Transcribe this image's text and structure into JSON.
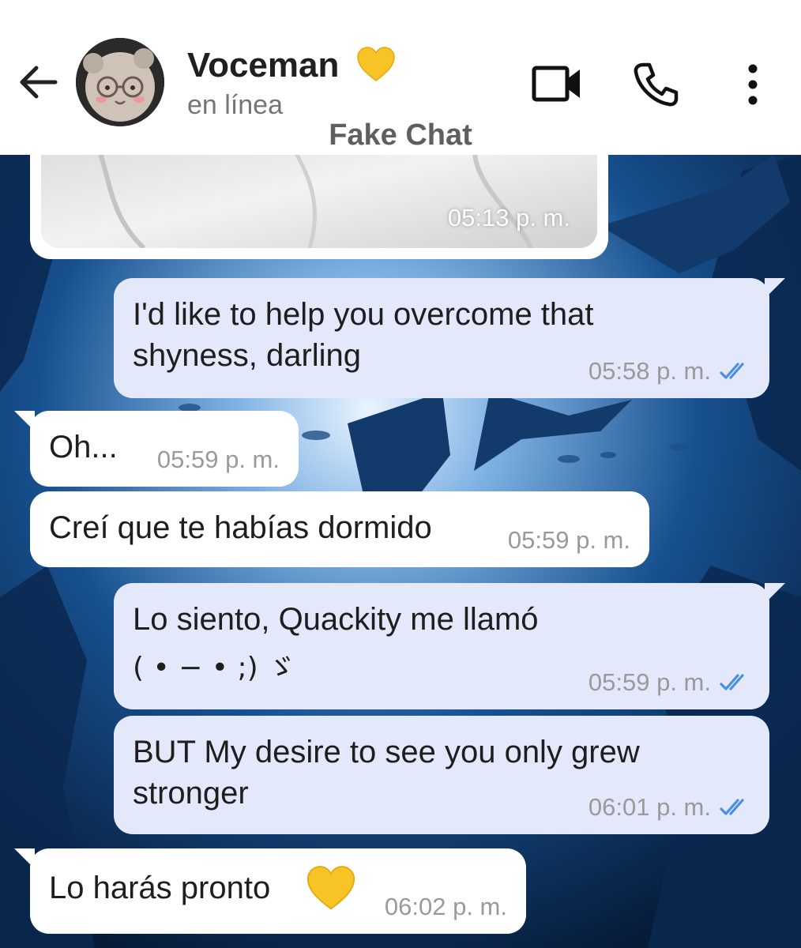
{
  "header": {
    "contact_name": "Voceman",
    "status": "en línea",
    "subtitle": "Fake Chat"
  },
  "icons": {
    "back": "arrow-left-icon",
    "video": "video-camera-icon",
    "call": "phone-icon",
    "menu": "more-vertical-icon",
    "heart": "yellow-heart-icon",
    "read": "double-check-icon"
  },
  "colors": {
    "incoming_bubble": "#ffffff",
    "outgoing_bubble": "#e3e8fb",
    "read_tick": "#4a90e2",
    "heart": "#f7c325"
  },
  "messages": [
    {
      "type": "image",
      "direction": "in",
      "time": "05:13 p. m."
    },
    {
      "direction": "out",
      "lines": [
        "I'd like to help you overcome that",
        "shyness, darling"
      ],
      "time": "05:58 p. m.",
      "read": true
    },
    {
      "direction": "in",
      "lines": [
        "Oh..."
      ],
      "time": "05:59 p. m."
    },
    {
      "direction": "in",
      "lines": [
        "Creí que te habías dormido"
      ],
      "time": "05:59 p. m."
    },
    {
      "direction": "out",
      "lines": [
        "Lo siento, Quackity me llamó",
        "( • − • ;) ゞ"
      ],
      "time": "05:59 p. m.",
      "read": true
    },
    {
      "direction": "out",
      "lines": [
        "BUT My desire to see you only grew",
        "stronger"
      ],
      "time": "06:01 p. m.",
      "read": true
    },
    {
      "direction": "in",
      "lines": [
        "Lo harás pronto"
      ],
      "time": "06:02 p. m.",
      "emoji": "yellow-heart"
    }
  ]
}
